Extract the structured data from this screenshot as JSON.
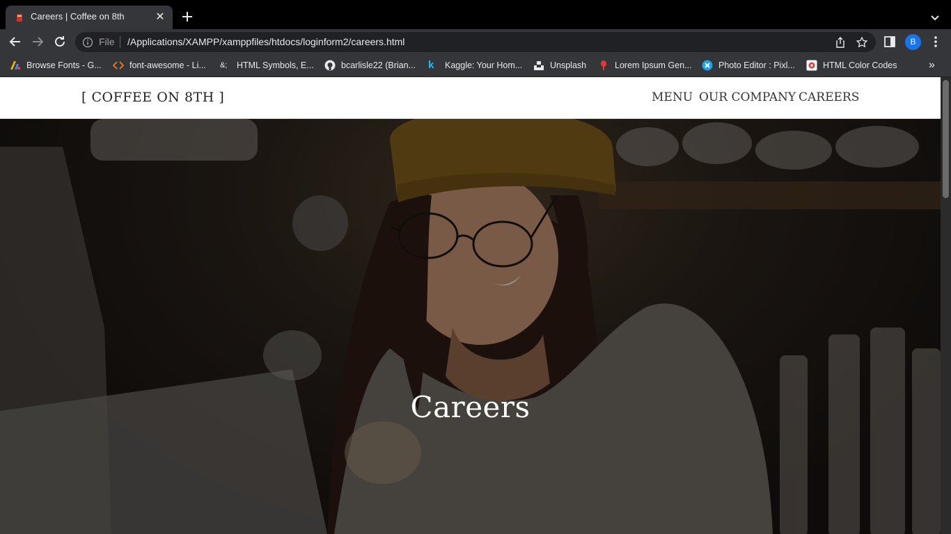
{
  "browser": {
    "tab": {
      "title": "Careers | Coffee on 8th",
      "favicon": "cup-icon"
    },
    "address": {
      "scheme_label": "File",
      "url": "/Applications/XAMPP/xamppfiles/htdocs/loginform2/careers.html"
    },
    "profile_initial": "B",
    "bookmarks": [
      {
        "label": "Browse Fonts - G...",
        "icon": "google-fonts-icon"
      },
      {
        "label": "font-awesome - Li...",
        "icon": "code-icon"
      },
      {
        "label": "HTML Symbols, E...",
        "icon": "ampersand-icon"
      },
      {
        "label": "bcarlisle22 (Brian...",
        "icon": "github-icon"
      },
      {
        "label": "Kaggle: Your Hom...",
        "icon": "kaggle-icon"
      },
      {
        "label": "Unsplash",
        "icon": "unsplash-icon"
      },
      {
        "label": "Lorem Ipsum Gen...",
        "icon": "lorem-icon"
      },
      {
        "label": "Photo Editor : Pixl...",
        "icon": "pixlr-icon"
      },
      {
        "label": "HTML Color Codes",
        "icon": "color-codes-icon"
      }
    ]
  },
  "site": {
    "brand": "[ COFFEE ON 8TH ]",
    "nav": [
      "MENU",
      "OUR COMPANY",
      "CAREERS"
    ],
    "hero_title": "Careers"
  }
}
